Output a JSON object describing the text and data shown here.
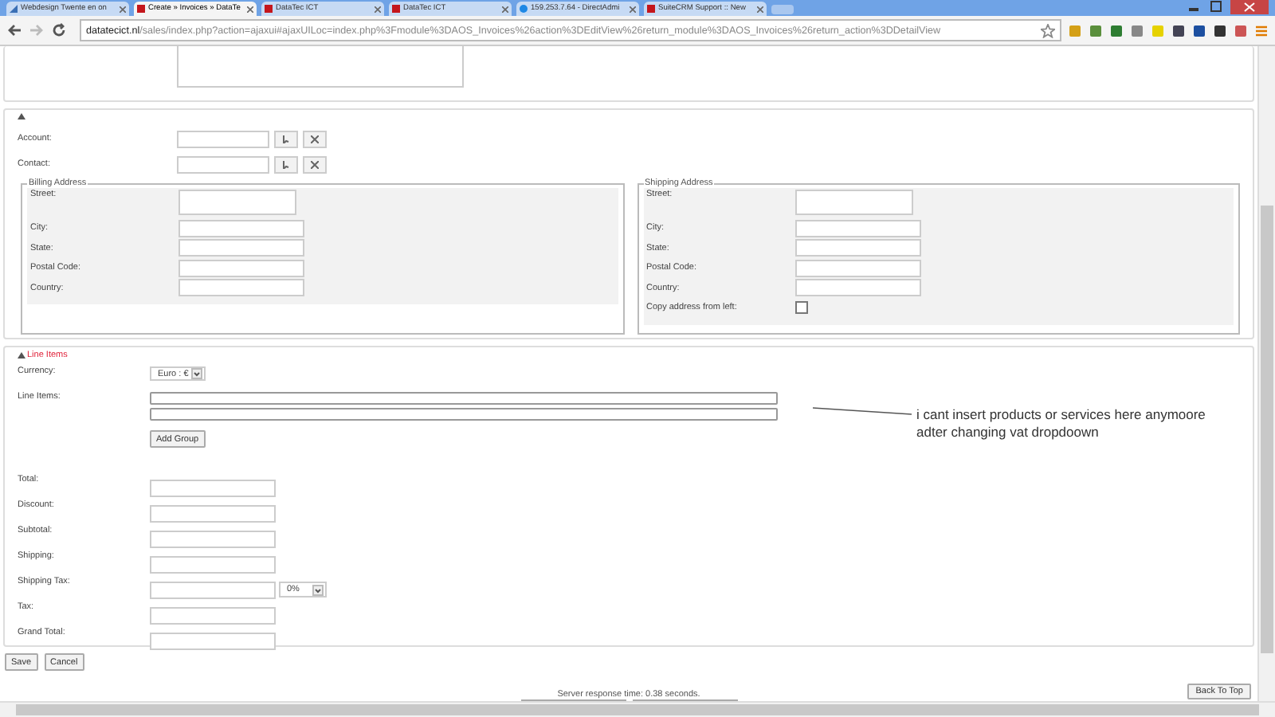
{
  "browser": {
    "tabs": [
      {
        "title": "Webdesign Twente en on",
        "selected": false,
        "kind": "chart"
      },
      {
        "title": "Create » Invoices » DataTe",
        "selected": true,
        "kind": "site"
      },
      {
        "title": "DataTec ICT",
        "selected": false,
        "kind": "site"
      },
      {
        "title": "DataTec ICT",
        "selected": false,
        "kind": "site"
      },
      {
        "title": "159.253.7.64 - DirectAdmi",
        "selected": false,
        "kind": "globe"
      },
      {
        "title": "SuiteCRM Support :: New",
        "selected": false,
        "kind": "site"
      }
    ],
    "url_host": "datatecict.nl",
    "url_path": "/sales/index.php?action=ajaxui#ajaxUILoc=index.php%3Fmodule%3DAOS_Invoices%26action%3DEditView%26return_module%3DAOS_Invoices%26return_action%3DDetailView"
  },
  "relations": {
    "fields": [
      {
        "label": "Account:"
      },
      {
        "label": "Contact:"
      }
    ]
  },
  "billing": {
    "legend": "Billing Address",
    "fields": [
      {
        "label": "Street:",
        "kind": "textarea"
      },
      {
        "label": "City:",
        "kind": "input"
      },
      {
        "label": "State:",
        "kind": "input"
      },
      {
        "label": "Postal Code:",
        "kind": "input"
      },
      {
        "label": "Country:",
        "kind": "input"
      }
    ]
  },
  "shipping": {
    "legend": "Shipping Address",
    "fields": [
      {
        "label": "Street:",
        "kind": "textarea"
      },
      {
        "label": "City:",
        "kind": "input"
      },
      {
        "label": "State:",
        "kind": "input"
      },
      {
        "label": "Postal Code:",
        "kind": "input"
      },
      {
        "label": "Country:",
        "kind": "input"
      }
    ],
    "copy": {
      "label": "Copy address from left:",
      "checked": false
    }
  },
  "line_items": {
    "heading": "Line Items",
    "currency_label": "Currency:",
    "currency_value": "Euro : €",
    "items_label": "Line Items:",
    "add_group": "Add Group",
    "totals": [
      {
        "label": "Total:",
        "kind": "input"
      },
      {
        "label": "Discount:",
        "kind": "input"
      },
      {
        "label": "Subtotal:",
        "kind": "input"
      },
      {
        "label": "Shipping:",
        "kind": "input"
      },
      {
        "label": "Shipping Tax:",
        "kind": "tax",
        "tax_value": "0%"
      },
      {
        "label": "Tax:",
        "kind": "input"
      },
      {
        "label": "Grand Total:",
        "kind": "input"
      }
    ]
  },
  "buttons": [
    "Save",
    "Cancel"
  ],
  "footer": {
    "response_time": "Server response time: 0.38 seconds.",
    "back_to_top": "Back To Top"
  },
  "annotation": {
    "lines": [
      "i cant insert products or services here anymoore",
      "adter changing vat dropdoown"
    ]
  }
}
